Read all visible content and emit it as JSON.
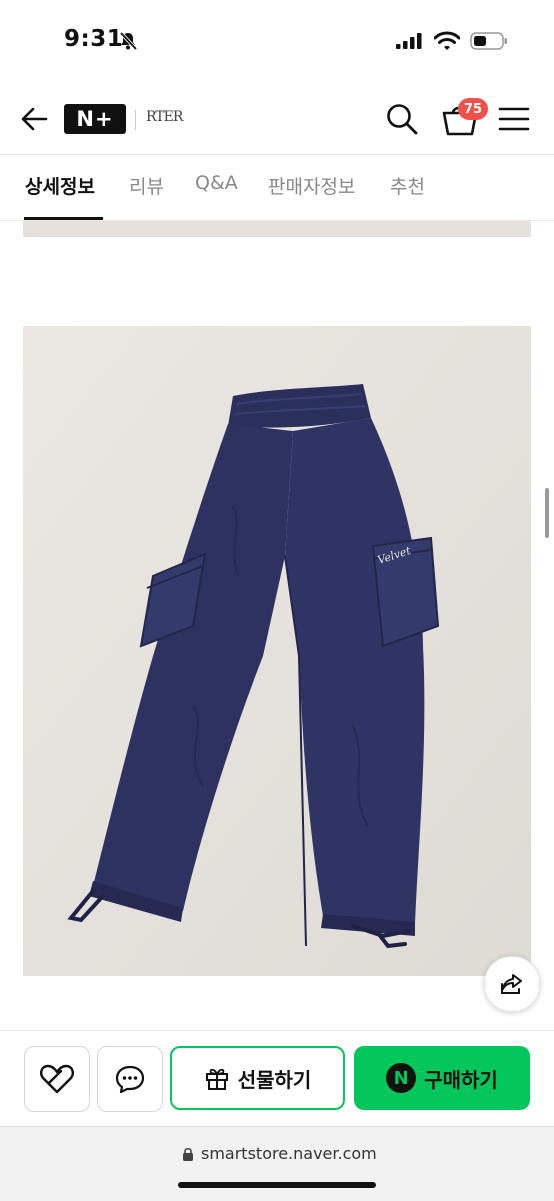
{
  "status_bar": {
    "time": "9:31",
    "icons": [
      "bell-slash-icon",
      "signal-icon",
      "wifi-icon",
      "battery-icon"
    ]
  },
  "header": {
    "logo": "N+",
    "brand_logo": "RTER",
    "cart_count": "75",
    "icons": [
      "back-arrow-icon",
      "search-icon",
      "cart-icon",
      "menu-icon"
    ]
  },
  "tabs": [
    {
      "label": "상세정보",
      "active": true
    },
    {
      "label": "리뷰",
      "active": false
    },
    {
      "label": "Q&A",
      "active": false
    },
    {
      "label": "판매자정보",
      "active": false
    },
    {
      "label": "추천",
      "active": false
    }
  ],
  "product_image": {
    "subject": "navy nylon cargo jogger pants with drawstring cuffs",
    "logo_text": "Velvet"
  },
  "actions": {
    "wish_icon": "heart-icon",
    "talk_icon": "chat-bubble-icon",
    "gift_label": "선물하기",
    "buy_badge": "N",
    "buy_label": "구매하기"
  },
  "browser": {
    "url": "smartstore.naver.com"
  },
  "colors": {
    "naver_green": "#03c75a",
    "badge_red": "#f0524a",
    "pants_navy": "#2e3260",
    "background_wall": "#e5e2dd"
  }
}
